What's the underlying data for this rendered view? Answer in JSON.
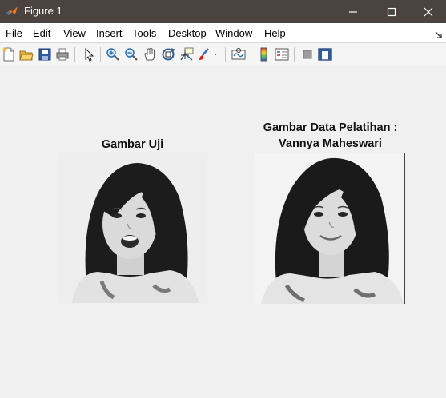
{
  "window": {
    "title": "Figure 1",
    "icons": {
      "app": "matlab-logo-icon",
      "minimize": "minimize-icon",
      "maximize": "maximize-icon",
      "close": "close-icon"
    }
  },
  "menu": {
    "items": [
      {
        "key": "F",
        "rest": "ile"
      },
      {
        "key": "E",
        "rest": "dit"
      },
      {
        "key": "V",
        "rest": "iew"
      },
      {
        "key": "I",
        "rest": "nsert"
      },
      {
        "key": "T",
        "rest": "ools"
      },
      {
        "key": "D",
        "rest": "esktop"
      },
      {
        "key": "W",
        "rest": "indow"
      },
      {
        "key": "H",
        "rest": "elp"
      }
    ]
  },
  "toolbar": {
    "icons": [
      "new-figure-icon",
      "open-file-icon",
      "save-icon",
      "print-icon",
      "edit-plot-arrow-icon",
      "zoom-in-icon",
      "zoom-out-icon",
      "pan-hand-icon",
      "rotate-3d-icon",
      "data-cursor-icon",
      "brush-icon",
      "link-plot-icon",
      "insert-colorbar-icon",
      "insert-legend-icon",
      "hide-plot-tools-icon",
      "show-plot-tools-icon"
    ]
  },
  "figure": {
    "left_axis": {
      "title": "Gambar Uji"
    },
    "right_axis": {
      "title_line1": "Gambar Data Pelatihan :",
      "title_line2": "Vannya Maheswari"
    }
  }
}
